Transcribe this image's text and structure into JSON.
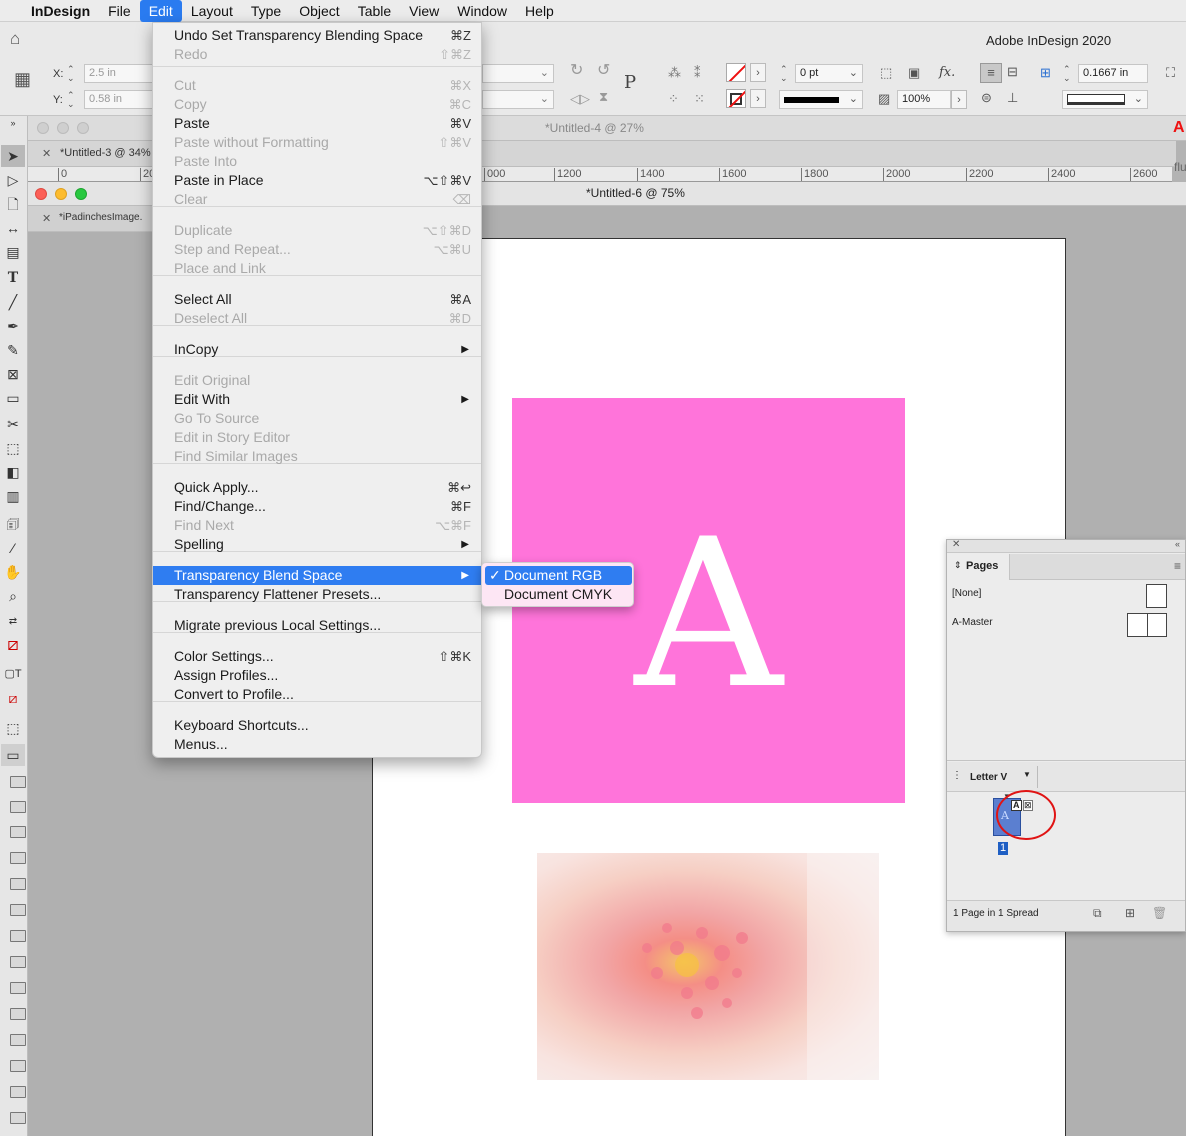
{
  "menubar": {
    "app": "InDesign",
    "items": [
      "File",
      "Edit",
      "Layout",
      "Type",
      "Object",
      "Table",
      "View",
      "Window",
      "Help"
    ],
    "active": "Edit"
  },
  "app_title": "Adobe InDesign 2020",
  "control": {
    "x_label": "X:",
    "x_value": "2.5 in",
    "y_label": "Y:",
    "y_value": "0.58 in",
    "stroke_weight": "0 pt",
    "zoom_percent": "100%",
    "spacing_value": "0.1667 in",
    "fx_label": "fx.",
    "p_label": "P"
  },
  "doc_tabs": {
    "untitled4": "*Untitled-4 @ 27%",
    "untitled3": "*Untitled-3 @ 34%",
    "untitled6": "*Untitled-6 @ 75%",
    "ipad": "*iPadinchesImage."
  },
  "ruler": [
    "0",
    "20",
    "1200",
    "1400",
    "1600",
    "1800",
    "2000",
    "2200",
    "2400",
    "2600",
    "000"
  ],
  "canvas": {
    "letter": "A",
    "pink_color": "#ff74da",
    "fl_text": "flu"
  },
  "edit_menu": [
    {
      "label": "Undo Set Transparency Blending Space",
      "shortcut": "⌘Z",
      "disabled": false
    },
    {
      "label": "Redo",
      "shortcut": "⇧⌘Z",
      "disabled": true
    },
    {
      "label": "Cut",
      "shortcut": "⌘X",
      "disabled": true
    },
    {
      "label": "Copy",
      "shortcut": "⌘C",
      "disabled": true
    },
    {
      "label": "Paste",
      "shortcut": "⌘V",
      "disabled": false
    },
    {
      "label": "Paste without Formatting",
      "shortcut": "⇧⌘V",
      "disabled": true
    },
    {
      "label": "Paste Into",
      "shortcut": "",
      "disabled": true
    },
    {
      "label": "Paste in Place",
      "shortcut": "⌥⇧⌘V",
      "disabled": false
    },
    {
      "label": "Clear",
      "shortcut": "⌫",
      "disabled": true
    },
    {
      "label": "Duplicate",
      "shortcut": "⌥⇧⌘D",
      "disabled": true
    },
    {
      "label": "Step and Repeat...",
      "shortcut": "⌥⌘U",
      "disabled": true
    },
    {
      "label": "Place and Link",
      "shortcut": "",
      "disabled": true
    },
    {
      "label": "Select All",
      "shortcut": "⌘A",
      "disabled": false
    },
    {
      "label": "Deselect All",
      "shortcut": "⌘D",
      "disabled": true
    },
    {
      "label": "InCopy",
      "shortcut": "",
      "disabled": false,
      "submenu": true
    },
    {
      "label": "Edit Original",
      "shortcut": "",
      "disabled": true
    },
    {
      "label": "Edit With",
      "shortcut": "",
      "disabled": false,
      "submenu": true
    },
    {
      "label": "Go To Source",
      "shortcut": "",
      "disabled": true
    },
    {
      "label": "Edit in Story Editor",
      "shortcut": "",
      "disabled": true
    },
    {
      "label": "Find Similar Images",
      "shortcut": "",
      "disabled": true
    },
    {
      "label": "Quick Apply...",
      "shortcut": "⌘↩",
      "disabled": false
    },
    {
      "label": "Find/Change...",
      "shortcut": "⌘F",
      "disabled": false
    },
    {
      "label": "Find Next",
      "shortcut": "⌥⌘F",
      "disabled": true
    },
    {
      "label": "Spelling",
      "shortcut": "",
      "disabled": false,
      "submenu": true
    },
    {
      "label": "Transparency Blend Space",
      "shortcut": "",
      "disabled": false,
      "submenu": true,
      "highlighted": true
    },
    {
      "label": "Transparency Flattener Presets...",
      "shortcut": "",
      "disabled": false
    },
    {
      "label": "Migrate previous Local Settings...",
      "shortcut": "",
      "disabled": false
    },
    {
      "label": "Color Settings...",
      "shortcut": "⇧⌘K",
      "disabled": false
    },
    {
      "label": "Assign Profiles...",
      "shortcut": "",
      "disabled": false
    },
    {
      "label": "Convert to Profile...",
      "shortcut": "",
      "disabled": false
    },
    {
      "label": "Keyboard Shortcuts...",
      "shortcut": "",
      "disabled": false
    },
    {
      "label": "Menus...",
      "shortcut": "",
      "disabled": false
    }
  ],
  "blend_submenu": {
    "checkmark": "✓",
    "items": [
      "Document RGB",
      "Document CMYK"
    ],
    "selected": "Document RGB"
  },
  "pages_panel": {
    "title": "Pages",
    "none_label": "[None]",
    "master_label": "A-Master",
    "size_label": "Letter V",
    "page_number": "1",
    "thumb_letter": "A",
    "status": "1 Page in 1 Spread"
  }
}
